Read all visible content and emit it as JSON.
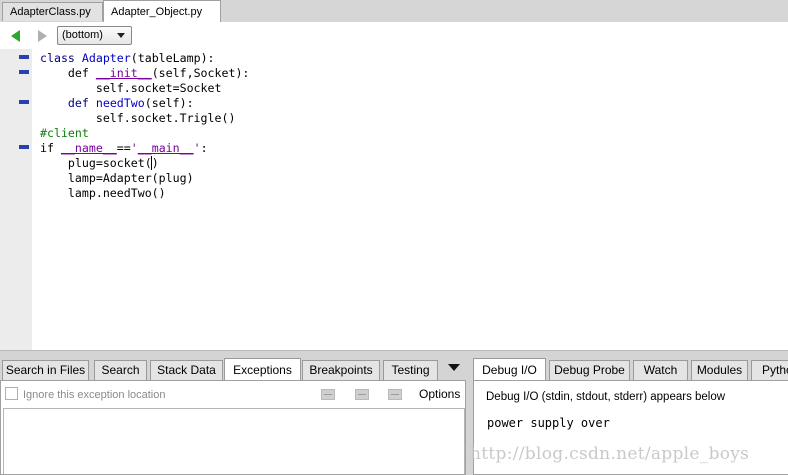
{
  "editor_tabs": [
    {
      "label": "AdapterClass.py",
      "active": false
    },
    {
      "label": "Adapter_Object.py",
      "active": true
    }
  ],
  "toolbar": {
    "back_icon": "left-arrow-icon",
    "forward_icon": "right-arrow-icon",
    "scope_value": "(bottom)"
  },
  "code_lines": [
    "class Adapter(tableLamp):",
    "    def __init__(self,Socket):",
    "        self.socket=Socket",
    "    def needTwo(self):",
    "        self.socket.Trigle()",
    "#client",
    "if __name__=='__main__':",
    "    plug=socket()",
    "    lamp=Adapter(plug)",
    "    lamp.needTwo()"
  ],
  "left_panel": {
    "tabs": [
      "Search in Files",
      "Search",
      "Stack Data",
      "Exceptions",
      "Breakpoints",
      "Testing"
    ],
    "active_tab": "Exceptions",
    "ignore_label": "Ignore this exception location",
    "options_label": "Options"
  },
  "right_panel": {
    "tabs": [
      "Debug I/O",
      "Debug Probe",
      "Watch",
      "Modules",
      "Pytho"
    ],
    "active_tab": "Debug I/O",
    "header": "Debug I/O (stdin, stdout, stderr) appears below",
    "output": "power supply over"
  },
  "watermark": "http://blog.csdn.net/apple_boys",
  "colors": {
    "keyword": "#00007f",
    "name": "#0000c8",
    "comment": "#0b7f0b",
    "dunder": "#7a00a0",
    "back_arrow": "#2ea52e"
  }
}
